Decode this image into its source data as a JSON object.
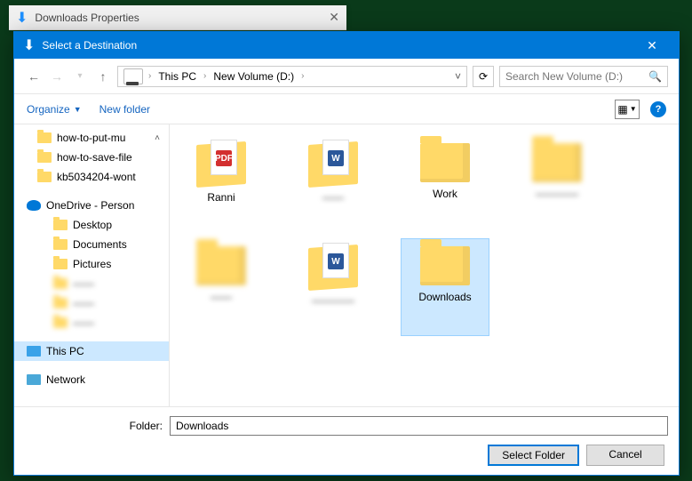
{
  "backgroundWindow": {
    "title": "Downloads Properties"
  },
  "dialog": {
    "title": "Select a Destination",
    "breadcrumb": {
      "root": "This PC",
      "drive": "New Volume (D:)"
    },
    "search": {
      "placeholder": "Search New Volume (D:)"
    },
    "toolbar": {
      "organize": "Organize",
      "newFolder": "New folder"
    },
    "tree": {
      "shortcuts": [
        "how-to-put-mu",
        "how-to-save-file",
        "kb5034204-wont"
      ],
      "onedrive": {
        "label": "OneDrive - Person",
        "children": [
          "Desktop",
          "Documents",
          "Pictures"
        ]
      },
      "thisPc": "This PC",
      "network": "Network"
    },
    "files": {
      "items": [
        {
          "name": "Ranni",
          "type": "doc-pdf"
        },
        {
          "name": "",
          "type": "doc-word",
          "blurLabel": true
        },
        {
          "name": "Work",
          "type": "folder"
        },
        {
          "name": "",
          "type": "folder",
          "blurIcon": true,
          "blurLabel": true
        },
        {
          "name": "",
          "type": "folder",
          "blurIcon": true,
          "blurLabel": true
        },
        {
          "name": "",
          "type": "doc-word",
          "blurLabel": true
        },
        {
          "name": "Downloads",
          "type": "folder",
          "selected": true
        }
      ]
    },
    "folderField": {
      "label": "Folder:",
      "value": "Downloads"
    },
    "buttons": {
      "select": "Select Folder",
      "cancel": "Cancel"
    }
  }
}
